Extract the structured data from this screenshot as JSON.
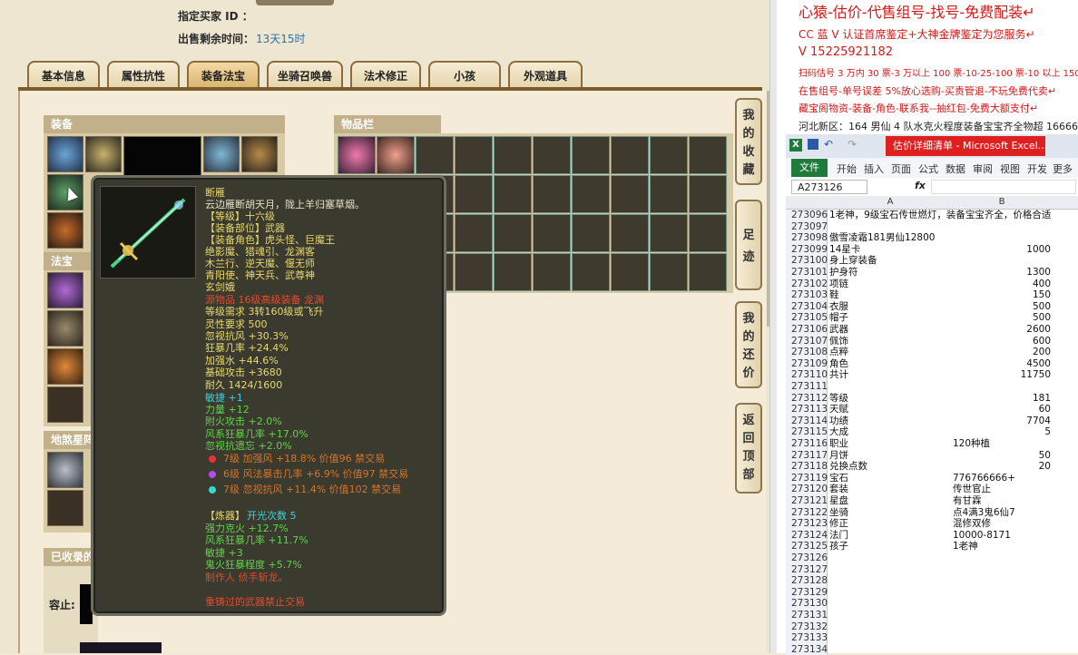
{
  "seller": {
    "buyer_label": "指定买家 ID ：",
    "remaining_label": "出售剩余时间：",
    "remaining_value": "13天15时"
  },
  "tabs": [
    "基本信息",
    "属性抗性",
    "装备法宝",
    "坐骑召唤兽",
    "法术修正",
    "小孩",
    "外观道具"
  ],
  "active_tab": 2,
  "sections": {
    "equip": "装备",
    "items": "物品栏",
    "fabao": "法宝",
    "dishaxing": "地煞星阵",
    "collected": "已收录的",
    "capacity": "容止:"
  },
  "side_buttons": [
    "我的收藏",
    "足迹",
    "我的还价",
    "返回顶部"
  ],
  "tooltip": {
    "name": "断雁",
    "desc": "云边雁断胡天月，陇上羊归塞草烟。",
    "level": "【等级】十六级",
    "part": "【装备部位】武器",
    "roles_line1": "【装备角色】虎头怪、巨魔王",
    "roles_line2": "绝影魔、猎魂引、龙渊客",
    "roles_line3": "木兰行、逆天魔、偃无师",
    "roles_line4": "青阳使、神天兵、武尊神",
    "roles_line5": "玄剑娥",
    "source": "源物品 16级高级装备 龙渊",
    "req_level": "等级需求 3转160级或飞升",
    "req_spirit": "灵性要求 500",
    "attr1": "忽视抗风 +30.3%",
    "attr2": "狂暴几率 +24.4%",
    "attr3": "加强水 +44.6%",
    "attr4": "基础攻击 +3680",
    "durability": "耐久 1424/1600",
    "agi": "敏捷 +1",
    "str": "力量 +12",
    "fire": "附火攻击 +2.0%",
    "windrate": "风系狂暴几率 +17.0%",
    "ignore_forget": "忽视抗遗忘 +2.0%",
    "gem1": "7级 加强风 +18.8% 价值96 禁交易",
    "gem2": "6级 风法暴击几率 +6.9% 价值97 禁交易",
    "gem3": "7级 忽视抗风 +11.4% 价值102 禁交易",
    "refine_label": "【炼器】",
    "refine_value": "开光次数 5",
    "ref1": "强力克火 +12.7%",
    "ref2": "风系狂暴几率 +11.7%",
    "ref3": "敏捷 +3",
    "ref4": "鬼火狂暴程度 +5.7%",
    "maker": "制作人 侦手斩龙。",
    "warn": "重铸过的武器禁止交易"
  },
  "ads": [
    "心猿-估价-代售组号-找号-免费配装↵",
    "CC 蓝 V 认证首席鉴定+大神金牌鉴定为您服务↵",
    "V 15225921182",
    "扫码估号 3 万内 30 票-3 万以上 100 票-10-25-100 票-10 以上 150",
    "在售组号-单号误差 5%放心选购-买责管退-不玩免费代卖↵",
    "藏宝阁物资-装备-角色-联系我--抽红包-免费大额支付↵",
    "河北新区：164 男仙 4 队水克火程度装备宝宝齐全物超 16666"
  ],
  "excel": {
    "window_title": "估价详细清单 - Microsoft Excel...",
    "ribbon": [
      "文件",
      "开始",
      "插入",
      "页面",
      "公式",
      "数据",
      "审阅",
      "视图",
      "开发",
      "更多"
    ],
    "name_box": "A273126",
    "fx": "fx",
    "col_a": "A",
    "col_b": "B",
    "rows": [
      {
        "n": "273096",
        "a": "1老神，9级宝石传世燃灯，装备宝宝齐全，价格合适",
        "b": ""
      },
      {
        "n": "273097",
        "a": "",
        "b": ""
      },
      {
        "n": "273098",
        "a": "傲雪凌霜181男仙12800",
        "b": ""
      },
      {
        "n": "273099",
        "a": "14星卡",
        "b": "1000"
      },
      {
        "n": "273100",
        "a": "身上穿装备",
        "b": ""
      },
      {
        "n": "273101",
        "a": "护身符",
        "b": "1300"
      },
      {
        "n": "273102",
        "a": "项链",
        "b": "400"
      },
      {
        "n": "273103",
        "a": "鞋",
        "b": "150"
      },
      {
        "n": "273104",
        "a": "衣服",
        "b": "500"
      },
      {
        "n": "273105",
        "a": "帽子",
        "b": "500"
      },
      {
        "n": "273106",
        "a": "武器",
        "b": "2600"
      },
      {
        "n": "273107",
        "a": "佩饰",
        "b": "600"
      },
      {
        "n": "273108",
        "a": "点粹",
        "b": "200"
      },
      {
        "n": "273109",
        "a": "角色",
        "b": "4500"
      },
      {
        "n": "273110",
        "a": "共计",
        "b": "11750"
      },
      {
        "n": "273111",
        "a": "",
        "b": ""
      },
      {
        "n": "273112",
        "a": "等级",
        "b": "181"
      },
      {
        "n": "273113",
        "a": "天赋",
        "b": "60"
      },
      {
        "n": "273114",
        "a": "功绩",
        "b": "7704"
      },
      {
        "n": "273115",
        "a": "大成",
        "b": "5"
      },
      {
        "n": "273116",
        "a": "职业",
        "b": "120种植"
      },
      {
        "n": "273117",
        "a": "月饼",
        "b": "50"
      },
      {
        "n": "273118",
        "a": "兑换点数",
        "b": "20"
      },
      {
        "n": "273119",
        "a": "宝石",
        "b": "776766666+"
      },
      {
        "n": "273120",
        "a": "套装",
        "b": "传世官止"
      },
      {
        "n": "273121",
        "a": "星盘",
        "b": "有甘霖"
      },
      {
        "n": "273122",
        "a": "坐骑",
        "b": "点4满3鬼6仙7"
      },
      {
        "n": "273123",
        "a": "修正",
        "b": "混修双修"
      },
      {
        "n": "273124",
        "a": "法门",
        "b": "10000-8171"
      },
      {
        "n": "273125",
        "a": "孩子",
        "b": "1老神"
      },
      {
        "n": "273126",
        "a": "",
        "b": ""
      },
      {
        "n": "273127",
        "a": "",
        "b": ""
      },
      {
        "n": "273128",
        "a": "",
        "b": ""
      },
      {
        "n": "273129",
        "a": "",
        "b": ""
      },
      {
        "n": "273130",
        "a": "",
        "b": ""
      },
      {
        "n": "273131",
        "a": "",
        "b": ""
      },
      {
        "n": "273132",
        "a": "",
        "b": ""
      },
      {
        "n": "273133",
        "a": "",
        "b": ""
      },
      {
        "n": "273134",
        "a": "",
        "b": ""
      }
    ]
  }
}
